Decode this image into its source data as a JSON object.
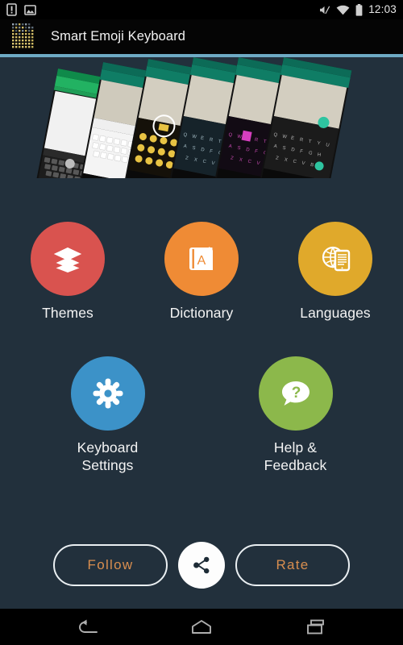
{
  "status_bar": {
    "time": "12:03",
    "left_icons": [
      {
        "name": "sim-warning-icon",
        "label": "SIM card alert"
      },
      {
        "name": "screenshot-icon",
        "label": "Screenshot captured"
      }
    ],
    "right_icons": [
      {
        "name": "volume-mute-icon",
        "label": "Silent mode"
      },
      {
        "name": "wifi-icon",
        "label": "Wi-Fi connected"
      },
      {
        "name": "battery-icon",
        "label": "Battery full"
      }
    ]
  },
  "app_bar": {
    "title": "Smart Emoji Keyboard",
    "icon": "emoji-grid-app-icon"
  },
  "theme": {
    "background": "#22303c",
    "accent_line": "#6eaac4",
    "title_bar": "#050505",
    "button_text": "#d98e4f",
    "button_border": "#eaeff2"
  },
  "banner": {
    "name": "keyboard-themes-banner",
    "alt": "Row of six phone screenshots showing different keyboard themes",
    "screens": 6
  },
  "menu": {
    "rows": [
      [
        {
          "id": "themes",
          "label": "Themes",
          "color": "#d9534f",
          "icon": "layers-icon"
        },
        {
          "id": "dictionary",
          "label": "Dictionary",
          "color": "#ef8b35",
          "icon": "book-a-icon"
        },
        {
          "id": "languages",
          "label": "Languages",
          "color": "#e0a92b",
          "icon": "globe-tablet-icon"
        }
      ],
      [
        {
          "id": "keyboard-settings",
          "label": "Keyboard\nSettings",
          "label_line1": "Keyboard",
          "label_line2": "Settings",
          "color": "#3c92c8",
          "icon": "gear-icon"
        },
        {
          "id": "help-feedback",
          "label": "Help &\nFeedback",
          "label_line1": "Help &",
          "label_line2": "Feedback",
          "color": "#8cb84b",
          "icon": "question-bubble-icon"
        }
      ]
    ]
  },
  "actions": {
    "follow_label": "Follow",
    "share_icon": "share-icon",
    "rate_label": "Rate"
  },
  "nav_bar": {
    "back": "back-icon",
    "home": "home-icon",
    "recents": "recents-icon"
  }
}
